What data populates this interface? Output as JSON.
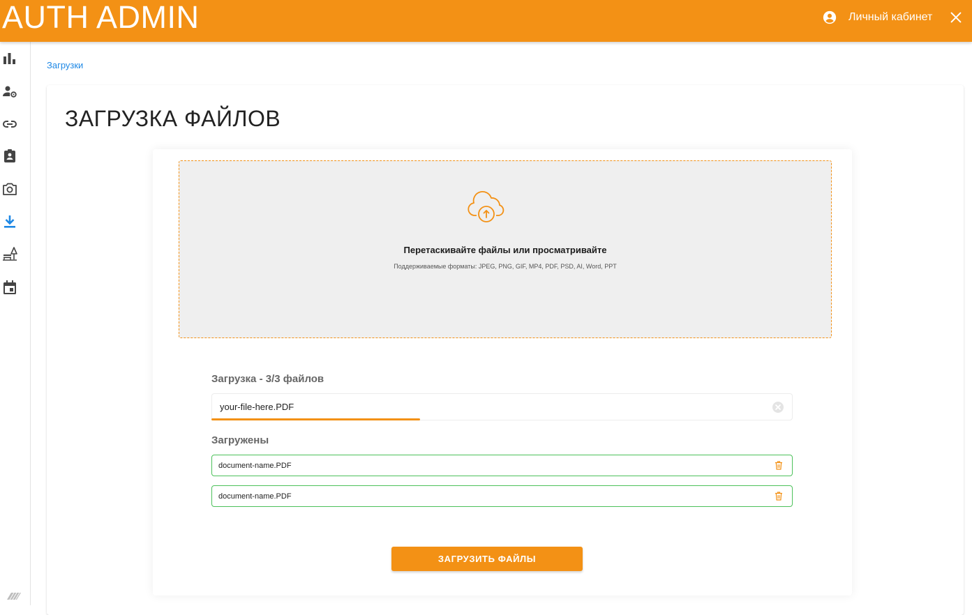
{
  "app": {
    "title": "AUTH ADMIN"
  },
  "header": {
    "account_label": "Личный кабинет"
  },
  "sidebar": {
    "items": [
      {
        "icon": "bar-chart-icon"
      },
      {
        "icon": "user-settings-icon"
      },
      {
        "icon": "link-icon"
      },
      {
        "icon": "assignment-ind-icon"
      },
      {
        "icon": "camera-icon"
      },
      {
        "icon": "download-icon",
        "active": true
      },
      {
        "icon": "park-bench-icon"
      },
      {
        "icon": "calendar-icon"
      }
    ]
  },
  "breadcrumb": {
    "current": "Загрузки"
  },
  "page": {
    "title": "ЗАГРУЗКА ФАЙЛОВ"
  },
  "dropzone": {
    "title": "Перетаскивайте файлы или просматривайте",
    "subtitle": "Поддерживаемые форматы: JPEG, PNG, GIF, MP4, PDF, PSD, AI, Word, PPT",
    "icon": "cloud-upload-icon"
  },
  "uploading": {
    "label": "Загрузка - 3/3 файлов",
    "file_name": "your-file-here.PDF",
    "progress": 0.36
  },
  "uploaded": {
    "label": "Загружены",
    "files": [
      {
        "name": "document-name.PDF"
      },
      {
        "name": "document-name.PDF"
      }
    ]
  },
  "actions": {
    "submit_label": "ЗАГРУЗИТЬ ФАЙЛЫ"
  },
  "colors": {
    "accent": "#F39115",
    "success": "#4CC15A",
    "link": "#1E88E5"
  }
}
